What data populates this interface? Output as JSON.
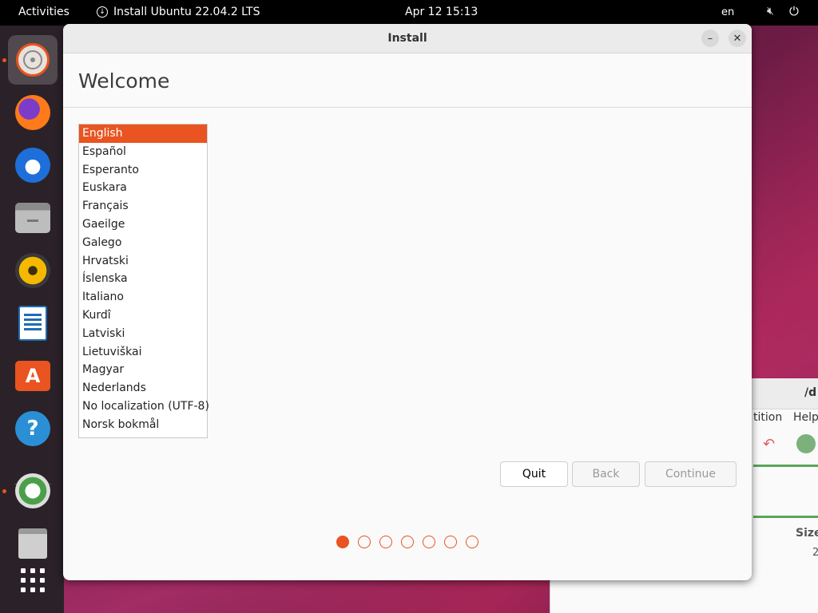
{
  "topbar": {
    "activities": "Activities",
    "app_indicator": "Install Ubuntu 22.04.2 LTS",
    "clock": "Apr 12  15:13",
    "language": "en",
    "icons": [
      "download-indicator-icon",
      "speaker-muted-icon",
      "power-icon"
    ]
  },
  "dock": {
    "items": [
      {
        "name": "installer",
        "icon": "ubuntu-installer-icon",
        "active": true
      },
      {
        "name": "firefox",
        "icon": "firefox-icon"
      },
      {
        "name": "thunderbird",
        "icon": "thunderbird-icon"
      },
      {
        "name": "files",
        "icon": "files-icon"
      },
      {
        "name": "rhythmbox",
        "icon": "rhythmbox-icon"
      },
      {
        "name": "writer",
        "icon": "libreoffice-writer-icon"
      },
      {
        "name": "software",
        "icon": "app-center-icon"
      },
      {
        "name": "help",
        "icon": "help-icon"
      },
      {
        "name": "gparted",
        "icon": "gparted-icon",
        "running": true
      },
      {
        "name": "trash",
        "icon": "trash-icon"
      },
      {
        "name": "show-apps",
        "icon": "app-grid-icon"
      }
    ],
    "colors": {
      "accent": "#e95420",
      "background": "#2a2228"
    }
  },
  "background_window": {
    "title": "/d",
    "menu_partition": "tition",
    "menu_help": "Help",
    "size_label": "Size",
    "size_value": "2"
  },
  "installer": {
    "window_title": "Install",
    "heading": "Welcome",
    "languages": [
      "English",
      "Español",
      "Esperanto",
      "Euskara",
      "Français",
      "Gaeilge",
      "Galego",
      "Hrvatski",
      "Íslenska",
      "Italiano",
      "Kurdî",
      "Latviski",
      "Lietuviškai",
      "Magyar",
      "Nederlands",
      "No localization (UTF-8)",
      "Norsk bokmål"
    ],
    "selected_language": "English",
    "buttons": {
      "quit": "Quit",
      "back": "Back",
      "continue": "Continue"
    },
    "progress": {
      "current_step": 1,
      "total_steps": 7
    },
    "accent_color": "#e95420"
  }
}
